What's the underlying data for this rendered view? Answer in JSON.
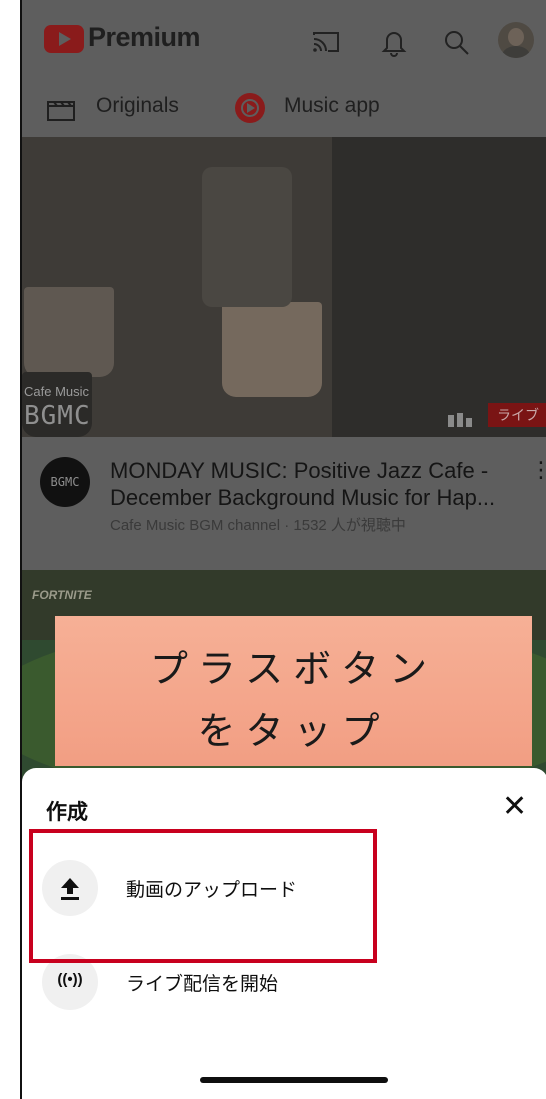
{
  "header": {
    "logo_text": "Premium",
    "brand_color": "#ff0000",
    "icons": [
      "cast-icon",
      "bell-icon",
      "search-icon",
      "avatar"
    ]
  },
  "chips": [
    {
      "label": "Originals",
      "icon": "clapperboard-icon"
    },
    {
      "label": "Music app",
      "icon": "music-app-icon"
    }
  ],
  "video1": {
    "thumb_brand_small": "Cafe Music",
    "thumb_brand_big": "BGMC",
    "live_badge": "ライブ",
    "channel_avatar_text": "BGMC",
    "title": "MONDAY MUSIC: Positive Jazz Cafe - December Background Music for Hap...",
    "meta": "Cafe Music BGM channel · 1532 人が視聴中"
  },
  "video2": {
    "thumb_label": "FORTNITE"
  },
  "callout": {
    "line1": "プラスボタン",
    "line2": "をタップ",
    "color": "#f4a88c"
  },
  "sheet": {
    "title": "作成",
    "close": "✕",
    "options": [
      {
        "label": "動画のアップロード",
        "icon": "upload-icon"
      },
      {
        "label": "ライブ配信を開始",
        "icon": "live-broadcast-icon",
        "icon_text": "((•))"
      }
    ],
    "highlight_color": "#c8001e"
  }
}
